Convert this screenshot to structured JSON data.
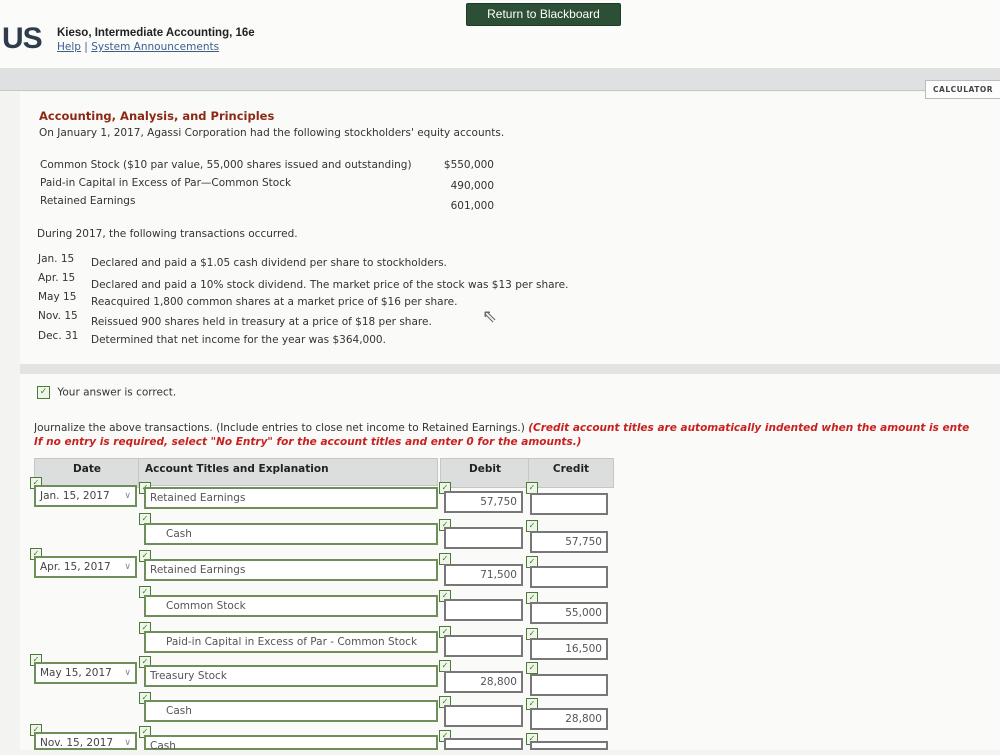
{
  "header": {
    "logo": "US",
    "book_title": "Kieso, Intermediate Accounting, 16e",
    "help": "Help",
    "divider": "|",
    "announcements": "System Announcements",
    "return_button": "Return to Blackboard",
    "calculator_button": "CALCULATOR"
  },
  "problem": {
    "title": "Accounting, Analysis, and Principles",
    "intro": "On January 1, 2017, Agassi Corporation had the following stockholders' equity accounts.",
    "equity": [
      {
        "label": "Common Stock ($10 par value, 55,000 shares issued and outstanding)",
        "value": "$550,000"
      },
      {
        "label": "Paid-in Capital in Excess of Par—Common Stock",
        "value": "490,000"
      },
      {
        "label": "Retained Earnings",
        "value": "601,000"
      }
    ],
    "during": "During 2017, the following transactions occurred.",
    "transactions": [
      {
        "date": "Jan. 15",
        "desc": "Declared and paid a $1.05 cash dividend per share to stockholders."
      },
      {
        "date": "Apr. 15",
        "desc": "Declared and paid a 10% stock dividend. The market price of the stock was $13 per share."
      },
      {
        "date": "May 15",
        "desc": "Reacquired 1,800 common shares at a market price of $16 per share."
      },
      {
        "date": "Nov. 15",
        "desc": "Reissued 900 shares held in treasury at a price of $18 per share."
      },
      {
        "date": "Dec. 31",
        "desc": "Determined that net income for the year was $364,000."
      }
    ]
  },
  "answer": {
    "status": "Your answer is correct.",
    "instruction_plain": "Journalize the above transactions. (Include entries to close net income to Retained Earnings.)",
    "instruction_red_1": "(Credit account titles are automatically indented when the amount is ente",
    "instruction_red_2": "If no entry is required, select \"No Entry\" for the account titles and enter 0 for the amounts.)"
  },
  "table": {
    "headers": {
      "date": "Date",
      "account": "Account Titles and Explanation",
      "debit": "Debit",
      "credit": "Credit"
    },
    "rows": [
      {
        "date": "Jan. 15, 2017",
        "account": "Retained Earnings",
        "debit": "57,750",
        "credit": ""
      },
      {
        "date": "",
        "account": "Cash",
        "debit": "",
        "credit": "57,750"
      },
      {
        "date": "Apr. 15, 2017",
        "account": "Retained Earnings",
        "debit": "71,500",
        "credit": ""
      },
      {
        "date": "",
        "account": "Common Stock",
        "debit": "",
        "credit": "55,000"
      },
      {
        "date": "",
        "account": "Paid-in Capital in Excess of Par - Common Stock",
        "debit": "",
        "credit": "16,500"
      },
      {
        "date": "May 15, 2017",
        "account": "Treasury Stock",
        "debit": "28,800",
        "credit": ""
      },
      {
        "date": "",
        "account": "Cash",
        "debit": "",
        "credit": "28,800"
      },
      {
        "date": "Nov. 15, 2017",
        "account": "Cash",
        "debit": "",
        "credit": ""
      }
    ]
  },
  "icons": {
    "check": "✓",
    "chevron": "∨",
    "cursor": "⇖"
  }
}
